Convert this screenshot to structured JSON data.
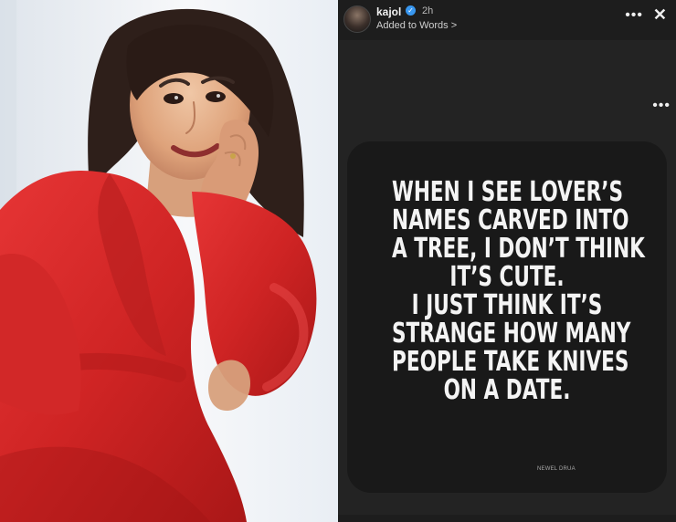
{
  "story": {
    "username": "kajol",
    "verified_icon": "verified-badge-icon",
    "time": "2h",
    "subtitle": "Added to Words >",
    "more_icon": "•••",
    "close_icon": "✕"
  },
  "quote": {
    "lines_1": [
      "WHEN I SEE LOVER’S",
      "NAMES CARVED INTO",
      "A TREE, I DON’T THINK",
      "IT’S CUTE."
    ],
    "lines_2": [
      "I JUST THINK IT’S",
      "STRANGE HOW MANY",
      "PEOPLE TAKE KNIVES",
      "ON A DATE."
    ],
    "signature": "NEWEL DRUA"
  },
  "colors": {
    "story_bg": "#232323",
    "card_bg": "#191919",
    "dress_red": "#d82b2b",
    "text_white": "#f4f4f4"
  }
}
